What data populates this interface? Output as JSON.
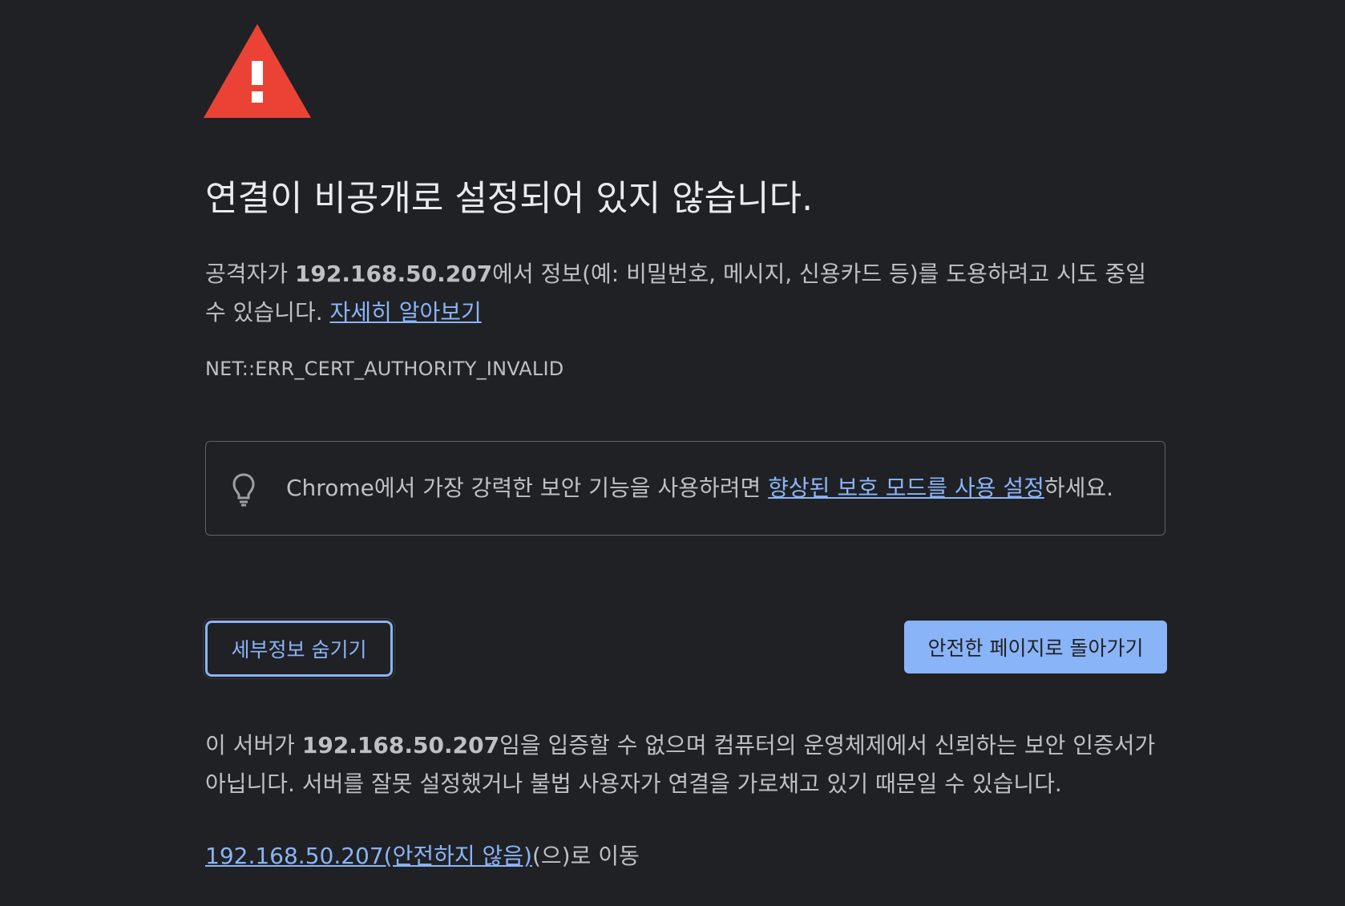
{
  "icons": {
    "warning": "warning-triangle-icon",
    "tip": "lightbulb-icon"
  },
  "colors": {
    "background": "#202124",
    "warning_red": "#ea4335",
    "link": "#8ab4f8",
    "primary_button": "#8ab4f8",
    "text": "#bdc1c6",
    "heading": "#e8eaed"
  },
  "heading": "연결이 비공개로 설정되어 있지 않습니다.",
  "attack_message": {
    "prefix": "공격자가 ",
    "host": "192.168.50.207",
    "suffix": "에서 정보(예: 비밀번호, 메시지, 신용카드 등)를 도용하려고 시도 중일 수 있습니다. ",
    "learn_more": "자세히 알아보기"
  },
  "error_code": "NET::ERR_CERT_AUTHORITY_INVALID",
  "tip": {
    "prefix": "Chrome에서 가장 강력한 보안 기능을 사용하려면 ",
    "link": "향상된 보호 모드를 사용 설정",
    "suffix": "하세요."
  },
  "buttons": {
    "hide_details": "세부정보 숨기기",
    "back_to_safety": "안전한 페이지로 돌아가기"
  },
  "details": {
    "prefix": "이 서버가 ",
    "host": "192.168.50.207",
    "suffix": "임을 입증할 수 없으며 컴퓨터의 운영체제에서 신뢰하는 보안 인증서가 아닙니다. 서버를 잘못 설정했거나 불법 사용자가 연결을 가로채고 있기 때문일 수 있습니다."
  },
  "proceed": {
    "link": "192.168.50.207(안전하지 않음)",
    "suffix": "(으)로 이동"
  }
}
